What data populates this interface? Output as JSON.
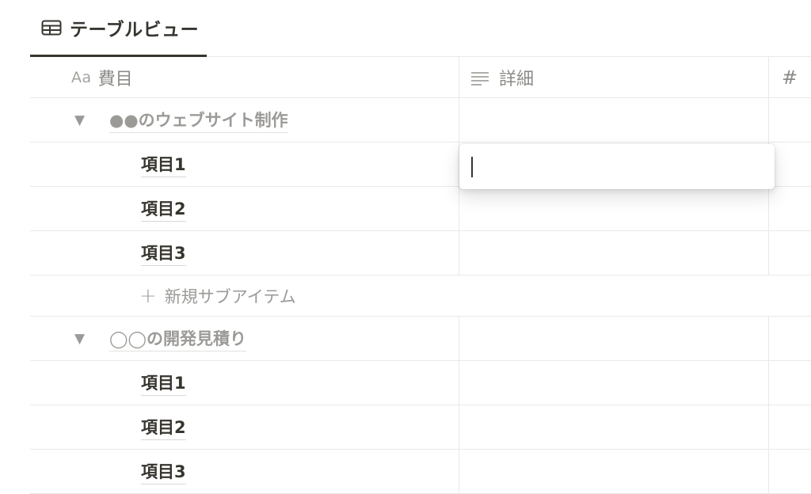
{
  "view_tab": {
    "icon": "table-icon",
    "label": "テーブルビュー"
  },
  "columns": [
    {
      "icon_text": "Aa",
      "icon": "title-property-icon",
      "label": "費目"
    },
    {
      "icon": "text-lines-icon",
      "label": "詳細"
    },
    {
      "icon_text": "#",
      "icon": "number-property-icon",
      "label": ""
    }
  ],
  "groups": [
    {
      "title": "●●のウェブサイト制作",
      "items": [
        "項目1",
        "項目2",
        "項目3"
      ],
      "add_label": "新規サブアイテム"
    },
    {
      "title": "◯◯の開発見積り",
      "items": [
        "項目1",
        "項目2",
        "項目3"
      ]
    }
  ],
  "caret_glyph": "▼",
  "plus_glyph": "+",
  "editor": {
    "value": "",
    "placeholder": ""
  },
  "colors": {
    "text": "#37352f",
    "muted": "#9b9a97",
    "border": "#e9e9e7",
    "tab_underline": "#37352f"
  }
}
